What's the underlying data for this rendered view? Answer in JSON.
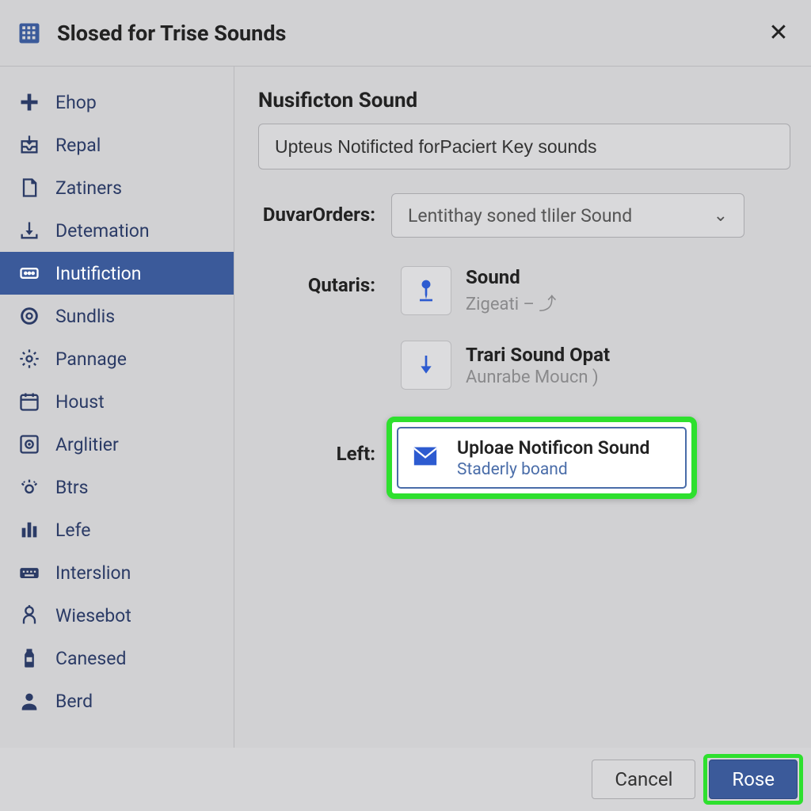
{
  "header": {
    "title": "Slosed for Trise Sounds"
  },
  "sidebar": {
    "items": [
      {
        "icon": "plus",
        "label": "Ehop"
      },
      {
        "icon": "inbox",
        "label": "Repal"
      },
      {
        "icon": "doc",
        "label": "Zatiners"
      },
      {
        "icon": "download",
        "label": "Detemation"
      },
      {
        "icon": "notif",
        "label": "Inutifiction",
        "selected": true
      },
      {
        "icon": "circle",
        "label": "Sundlis"
      },
      {
        "icon": "gear",
        "label": "Pannage"
      },
      {
        "icon": "calendar",
        "label": "Houst"
      },
      {
        "icon": "disk",
        "label": "Arglitier"
      },
      {
        "icon": "bright",
        "label": "Btrs"
      },
      {
        "icon": "bars",
        "label": "Lefe"
      },
      {
        "icon": "keyboard",
        "label": "Interslion"
      },
      {
        "icon": "robot",
        "label": "Wiesebot"
      },
      {
        "icon": "bottle",
        "label": "Canesed"
      },
      {
        "icon": "user",
        "label": "Berd"
      }
    ]
  },
  "main": {
    "section_title": "Nusificton Sound",
    "input_value": "Upteus Notificted forPaciert Key sounds",
    "order_label": "DuvarOrders:",
    "order_value": "Lentithay soned tliler Sound",
    "qutaris_label": "Qutaris:",
    "left_label": "Left:",
    "options": [
      {
        "title": "Sound",
        "sub": "Zigeati – ⤴",
        "icon": "pin"
      },
      {
        "title": "Trari Sound Opat",
        "sub": "Aunrabe Moucn )",
        "icon": "down"
      }
    ],
    "upload": {
      "title": "Uploae Notificon Sound",
      "sub": "Staderly boand"
    }
  },
  "footer": {
    "cancel_label": "Cancel",
    "primary_label": "Rose"
  },
  "colors": {
    "accent": "#3b5a9a",
    "highlight": "#2ee02e"
  }
}
